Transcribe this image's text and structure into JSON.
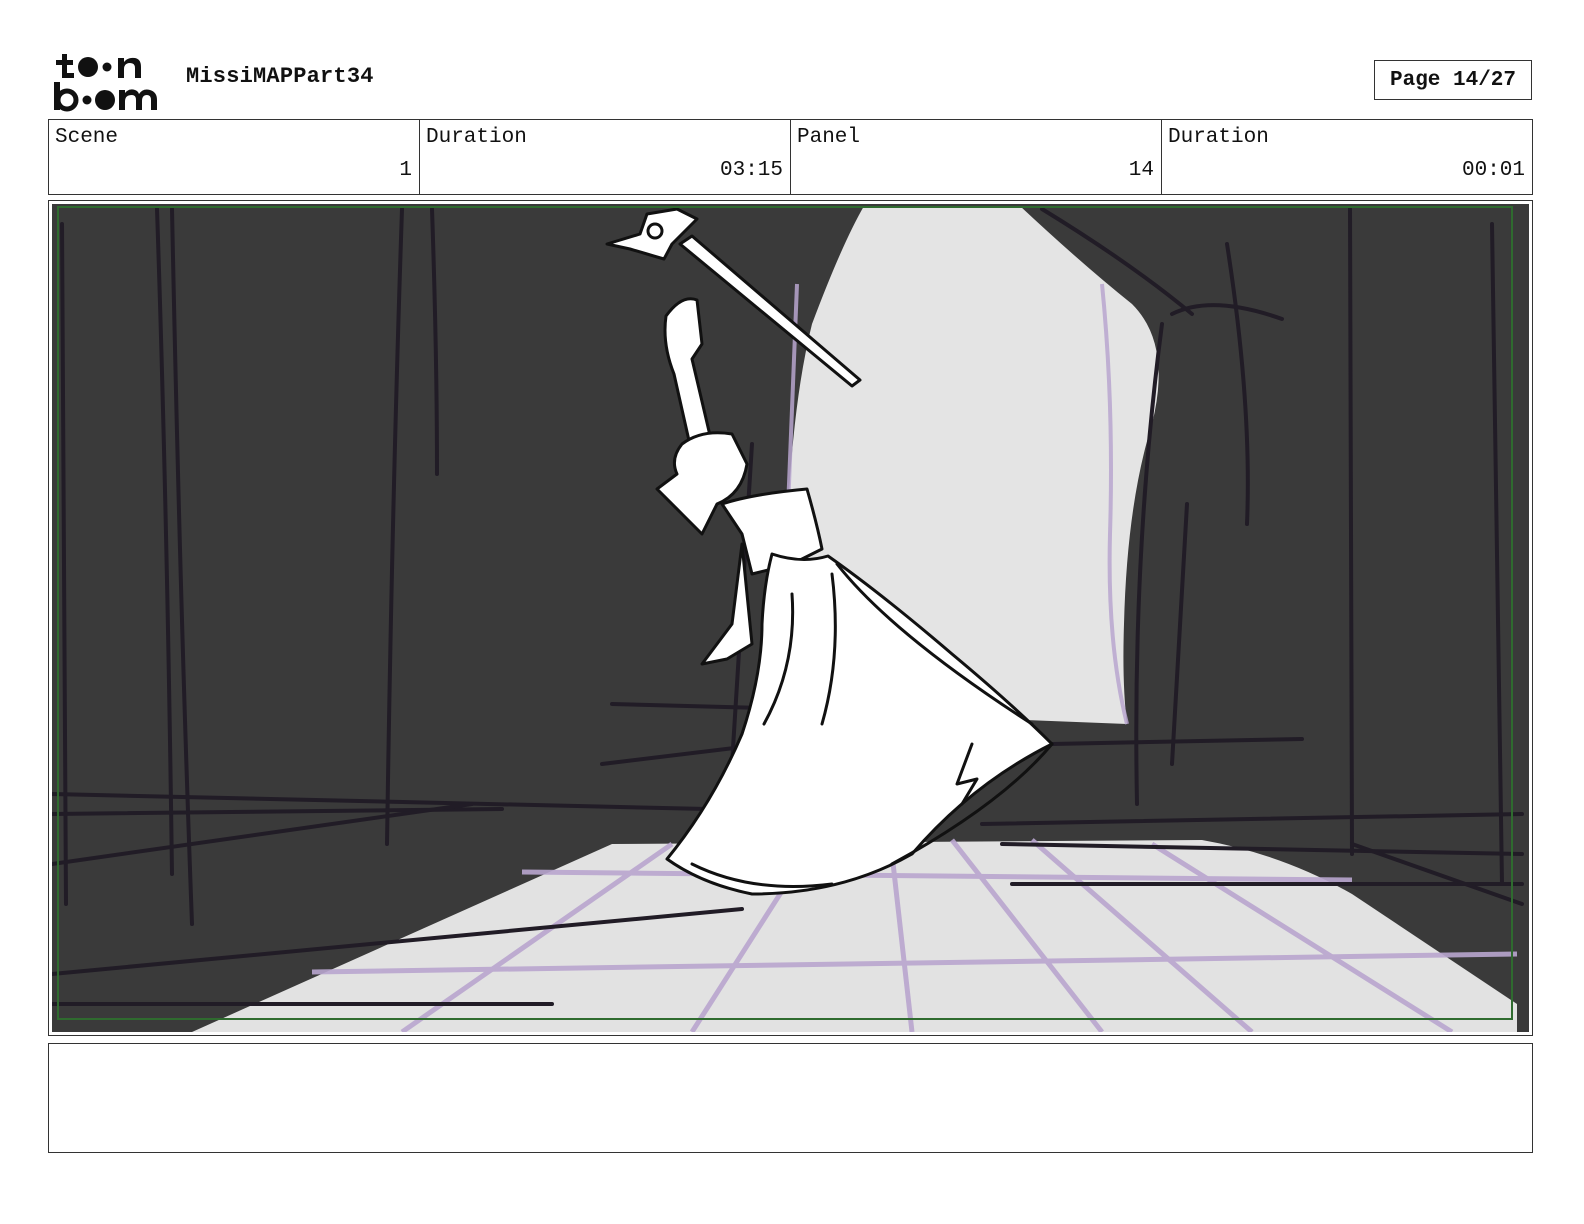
{
  "header": {
    "logo_text": "toon boom",
    "project_title": "MissiMAPPart34",
    "page_label": "Page 14/27"
  },
  "info": {
    "scene": {
      "label": "Scene",
      "value": "1"
    },
    "scene_duration": {
      "label": "Duration",
      "value": "03:15"
    },
    "panel": {
      "label": "Panel",
      "value": "14"
    },
    "panel_duration": {
      "label": "Duration",
      "value": "00:01"
    }
  },
  "colors": {
    "curtain": "#3a3a3a",
    "backlight": "#e4e4e4",
    "floor": "#e2e2e2",
    "grid": "#b9a6cf",
    "frame_green": "#2f6b2f"
  },
  "notes": {
    "text": ""
  }
}
